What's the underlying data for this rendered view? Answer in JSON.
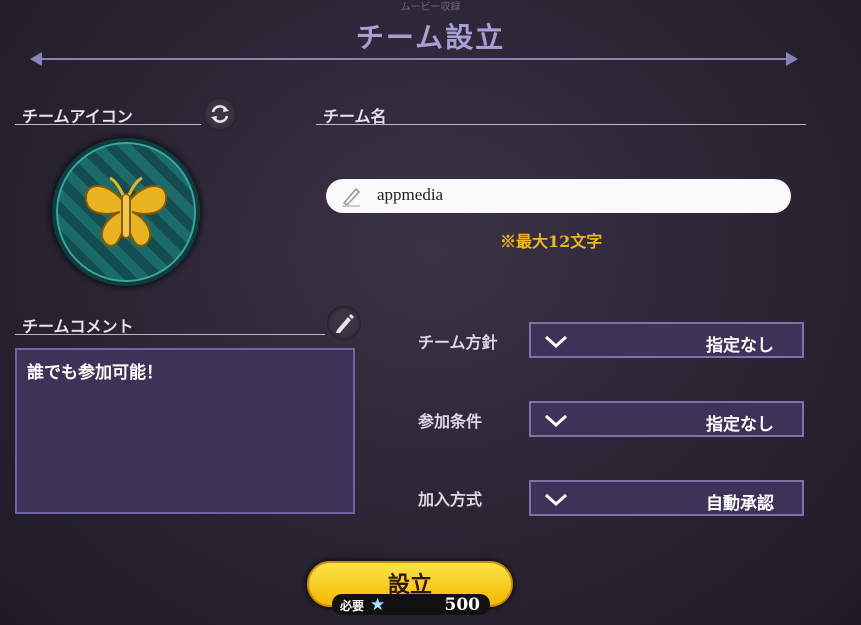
{
  "header": {
    "caption": "ムービー収録",
    "title": "チーム設立"
  },
  "icon_section": {
    "label": "チームアイコン",
    "refresh_icon": "refresh-icon",
    "emblem_icon": "butterfly-emblem"
  },
  "name_section": {
    "label": "チーム名",
    "value": "appmedia",
    "pen_icon": "pen-icon",
    "note": "※最大12文字"
  },
  "comment_section": {
    "label": "チームコメント",
    "edit_icon": "pencil-icon",
    "value": "誰でも参加可能！"
  },
  "settings": [
    {
      "label": "チーム方針",
      "value": "指定なし"
    },
    {
      "label": "参加条件",
      "value": "指定なし"
    },
    {
      "label": "加入方式",
      "value": "自動承認"
    }
  ],
  "submit": {
    "label": "設立",
    "cost_label": "必要",
    "cost_icon": "star-gem-icon",
    "cost_value": "500"
  },
  "colors": {
    "accent": "#a79fd6",
    "note": "#f0b520",
    "button": "#f3b800",
    "panel": "#3d3358"
  }
}
